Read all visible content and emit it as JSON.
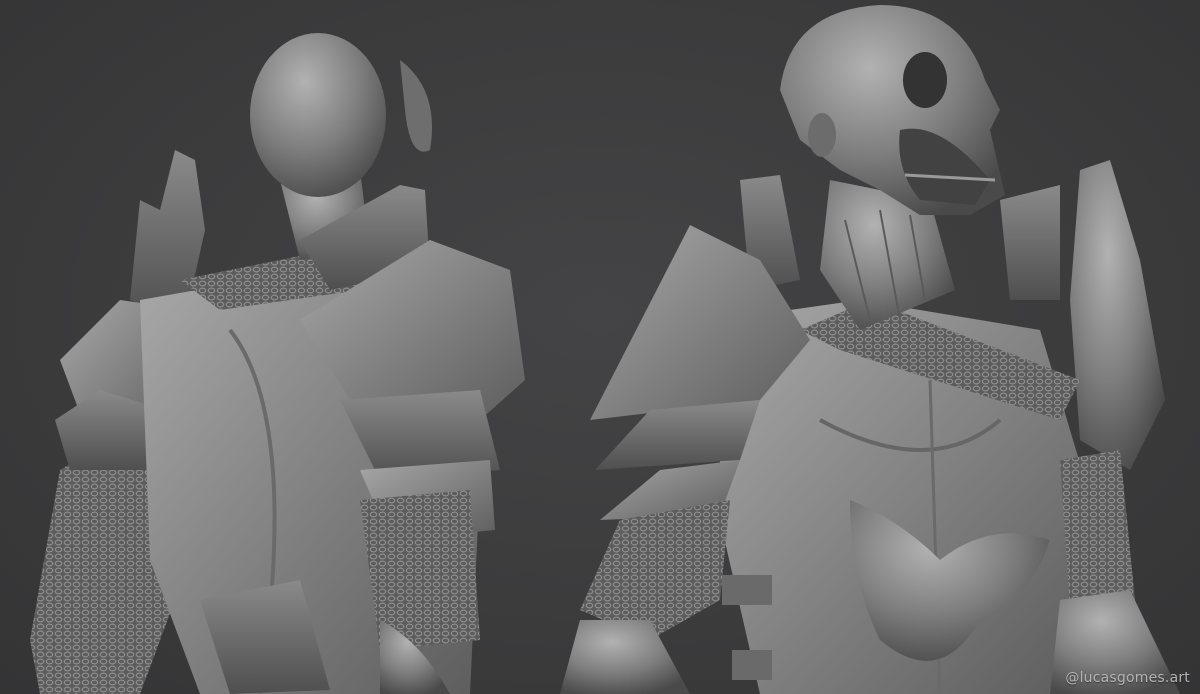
{
  "colors": {
    "background": "#3b3b3c",
    "clay_light": "#a6a6a6",
    "clay_mid": "#7c7c7c",
    "clay_dark": "#4e4e4e"
  },
  "watermark": {
    "text": "@lucasgomes.art"
  }
}
